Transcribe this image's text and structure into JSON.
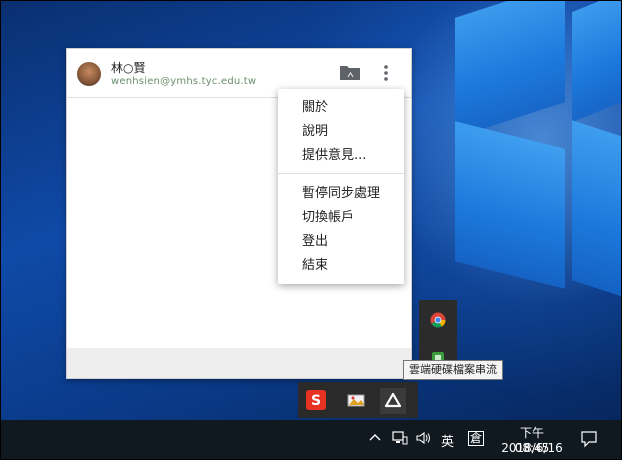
{
  "app": {
    "user_name": "林○賢",
    "user_email": "wenhsien@ymhs.tyc.edu.tw",
    "folder_icon": "drive-folder-icon",
    "more_icon": "more-vert-icon"
  },
  "menu": {
    "items": [
      "關於",
      "說明",
      "提供意見...",
      "暫停同步處理",
      "切換帳戶",
      "登出",
      "結束"
    ]
  },
  "tray": {
    "tooltip": "雲端硬碟檔案串流",
    "ime_lang": "英",
    "ime_mode": "倉"
  },
  "clock": {
    "time": "下午 08:45",
    "date": "2018/6/16"
  },
  "colors": {
    "drive_icon": "#5f6368",
    "accent": "#1a73e8"
  }
}
